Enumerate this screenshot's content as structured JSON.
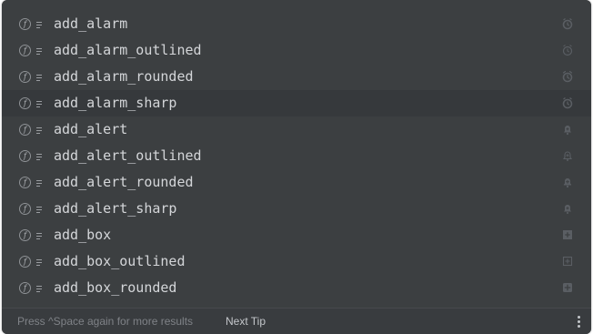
{
  "completion_popup": {
    "items": [
      {
        "label": "add_alarm",
        "kind_icon": "function-icon",
        "type_icon": "field-icon",
        "preview_icon": "alarm-icon"
      },
      {
        "label": "add_alarm_outlined",
        "kind_icon": "function-icon",
        "type_icon": "field-icon",
        "preview_icon": "alarm-outlined-icon"
      },
      {
        "label": "add_alarm_rounded",
        "kind_icon": "function-icon",
        "type_icon": "field-icon",
        "preview_icon": "alarm-rounded-icon"
      },
      {
        "label": "add_alarm_sharp",
        "kind_icon": "function-icon",
        "type_icon": "field-icon",
        "preview_icon": "alarm-sharp-icon",
        "selected": true
      },
      {
        "label": "add_alert",
        "kind_icon": "function-icon",
        "type_icon": "field-icon",
        "preview_icon": "alert-icon"
      },
      {
        "label": "add_alert_outlined",
        "kind_icon": "function-icon",
        "type_icon": "field-icon",
        "preview_icon": "alert-outlined-icon"
      },
      {
        "label": "add_alert_rounded",
        "kind_icon": "function-icon",
        "type_icon": "field-icon",
        "preview_icon": "alert-rounded-icon"
      },
      {
        "label": "add_alert_sharp",
        "kind_icon": "function-icon",
        "type_icon": "field-icon",
        "preview_icon": "alert-sharp-icon"
      },
      {
        "label": "add_box",
        "kind_icon": "function-icon",
        "type_icon": "field-icon",
        "preview_icon": "add-box-icon"
      },
      {
        "label": "add_box_outlined",
        "kind_icon": "function-icon",
        "type_icon": "field-icon",
        "preview_icon": "add-box-outlined-icon"
      },
      {
        "label": "add_box_rounded",
        "kind_icon": "function-icon",
        "type_icon": "field-icon",
        "preview_icon": "add-box-rounded-icon"
      }
    ]
  },
  "footer": {
    "hint": "Press ^Space again for more results",
    "next_tip": "Next Tip",
    "menu_icon": "more-vertical-icon"
  },
  "colors": {
    "popup_background": "#3c3f41",
    "selected_row": "#36393c",
    "item_text": "#d4d6d9",
    "hint_text": "#7f8287",
    "link_text": "#c4c7cb"
  }
}
